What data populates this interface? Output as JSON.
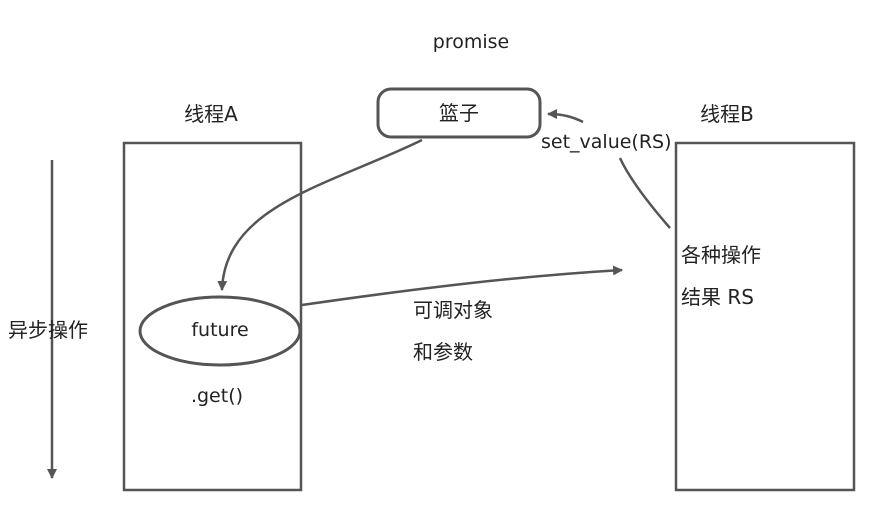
{
  "title": "promise",
  "thread_a": {
    "label": "线程A",
    "future_label": "future",
    "get_label": ".get()"
  },
  "thread_b": {
    "label": "线程B",
    "ops_label": "各种操作",
    "result_label": "结果 RS"
  },
  "basket_label": "篮子",
  "set_value_label": "set_value(RS)",
  "callable_label_1": "可调对象",
  "callable_label_2": "和参数",
  "async_label": "异步操作",
  "colors": {
    "stroke": "#555555",
    "text": "#222222",
    "background": "#ffffff"
  }
}
